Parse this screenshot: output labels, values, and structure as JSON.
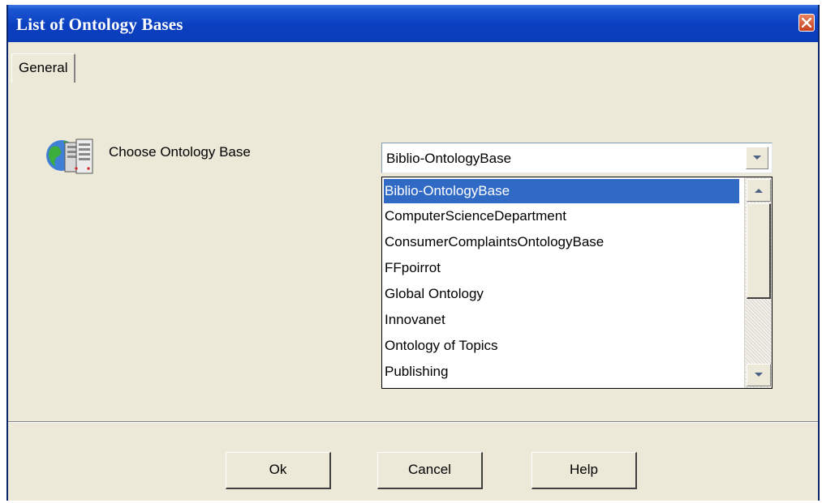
{
  "window": {
    "title": "List of Ontology Bases"
  },
  "tabs": [
    {
      "label": "General"
    }
  ],
  "form": {
    "label": "Choose Ontology Base",
    "icon": "database-globe-icon",
    "selected_value": "Biblio-OntologyBase",
    "options": [
      "Biblio-OntologyBase",
      "ComputerScienceDepartment",
      "ConsumerComplaintsOntologyBase",
      "FFpoirrot",
      "Global Ontology",
      "Innovanet",
      "Ontology of Topics",
      "Publishing"
    ]
  },
  "buttons": {
    "ok": "Ok",
    "cancel": "Cancel",
    "help": "Help"
  },
  "colors": {
    "titlebar": "#0a3fc0",
    "selection": "#316ac5",
    "face": "#ece9d8",
    "close": "#c64121"
  }
}
